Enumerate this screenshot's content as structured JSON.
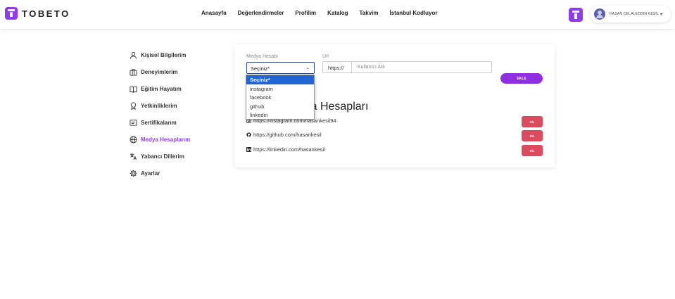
{
  "brand": {
    "name": "TOBETO"
  },
  "nav": {
    "links": [
      "Anasayfa",
      "Değerlendirmeler",
      "Profilim",
      "Katalog",
      "Takvim",
      "İstanbul Kodluyor"
    ]
  },
  "user": {
    "name": "HASAN CELALEDDIN KESİL",
    "caret": "▾"
  },
  "sidebar": {
    "items": [
      {
        "label": "Kişisel Bilgilerim",
        "icon": "user-icon"
      },
      {
        "label": "Deneyimlerim",
        "icon": "briefcase-icon"
      },
      {
        "label": "Eğitim Hayatım",
        "icon": "book-icon"
      },
      {
        "label": "Yetkinliklerim",
        "icon": "award-icon"
      },
      {
        "label": "Sertifikalarım",
        "icon": "certificate-icon"
      },
      {
        "label": "Medya Hesaplarım",
        "icon": "globe-icon",
        "active": true
      },
      {
        "label": "Yabancı Dillerim",
        "icon": "translate-icon"
      },
      {
        "label": "Ayarlar",
        "icon": "gear-icon"
      }
    ]
  },
  "form": {
    "account_label": "Medya Hesabı",
    "account_value": "Seçiniz*",
    "url_label": "Url",
    "url_prefix": "https://",
    "url_placeholder": "Kullanıcı Adı",
    "add_label": "EKLE"
  },
  "dropdown": {
    "options": [
      "Seçiniz*",
      "instagram",
      "facebook",
      "github",
      "linkedin"
    ],
    "selected_index": 0
  },
  "accounts": {
    "title": "Sosyal Medya Hesapları",
    "items": [
      {
        "url": "https://instagram.com/hasankesil94",
        "icon": "instagram-icon"
      },
      {
        "url": "https://github.com/hasankesil",
        "icon": "github-icon"
      },
      {
        "url": "https://linkedin.com/hasankesil",
        "icon": "linkedin-icon"
      }
    ],
    "delete_label": "SİL"
  },
  "colors": {
    "accent": "#8f3dea",
    "danger": "#dc4a5e",
    "select_highlight": "#1f66d4"
  }
}
